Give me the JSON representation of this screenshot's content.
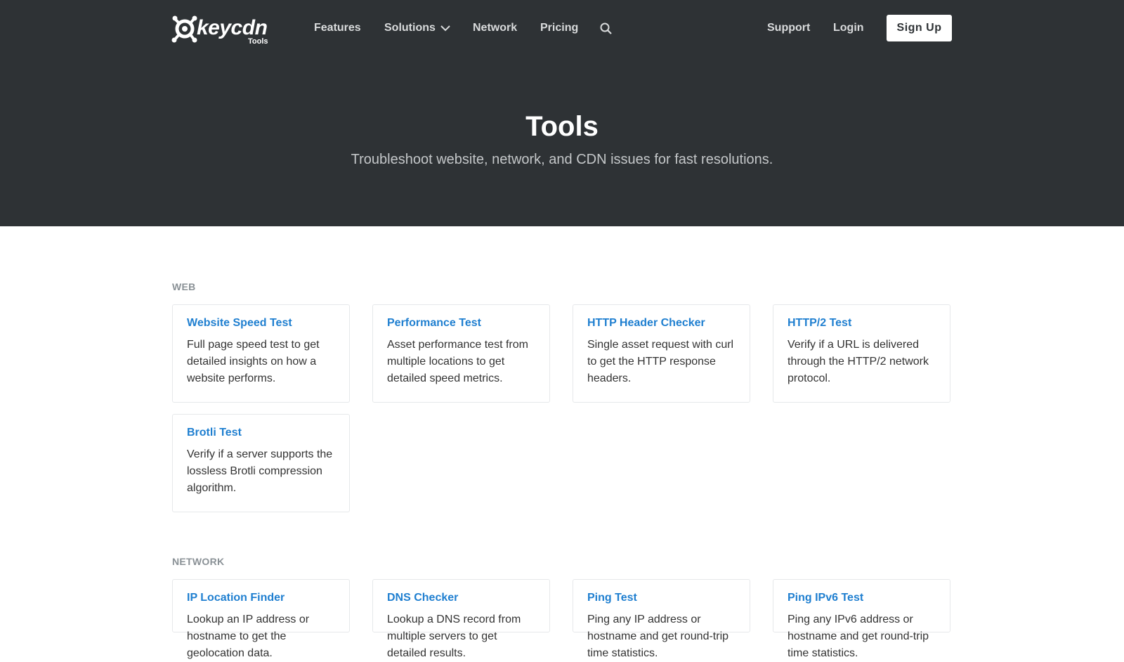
{
  "header": {
    "logo": {
      "wordmark": "keycdn",
      "subtitle": "Tools"
    },
    "nav": {
      "features": "Features",
      "solutions": "Solutions",
      "network": "Network",
      "pricing": "Pricing",
      "support": "Support",
      "login": "Login",
      "signup": "Sign Up"
    },
    "icons": {
      "search": "search-icon",
      "solutions_dropdown": "chevron-down-icon"
    }
  },
  "hero": {
    "title": "Tools",
    "subtitle": "Troubleshoot website, network, and CDN issues for fast resolutions."
  },
  "sections": [
    {
      "label": "WEB",
      "cards": [
        {
          "title": "Website Speed Test",
          "desc": "Full page speed test to get detailed insights on how a website performs."
        },
        {
          "title": "Performance Test",
          "desc": "Asset performance test from multiple locations to get detailed speed metrics."
        },
        {
          "title": "HTTP Header Checker",
          "desc": "Single asset request with curl to get the HTTP response headers."
        },
        {
          "title": "HTTP/2 Test",
          "desc": "Verify if a URL is delivered through the HTTP/2 network protocol."
        },
        {
          "title": "Brotli Test",
          "desc": "Verify if a server supports the lossless Brotli compression algorithm."
        }
      ]
    },
    {
      "label": "NETWORK",
      "cards": [
        {
          "title": "IP Location Finder",
          "desc": "Lookup an IP address or hostname to get the geolocation data."
        },
        {
          "title": "DNS Checker",
          "desc": "Lookup a DNS record from multiple servers to get detailed results."
        },
        {
          "title": "Ping Test",
          "desc": "Ping any IP address or hostname and get round-trip time statistics."
        },
        {
          "title": "Ping IPv6 Test",
          "desc": "Ping any IPv6 address or hostname and get round-trip time statistics."
        }
      ]
    }
  ],
  "colors": {
    "header_bg": "#2e3235",
    "link_blue": "#1f7fd0",
    "section_label": "#8a9196"
  }
}
